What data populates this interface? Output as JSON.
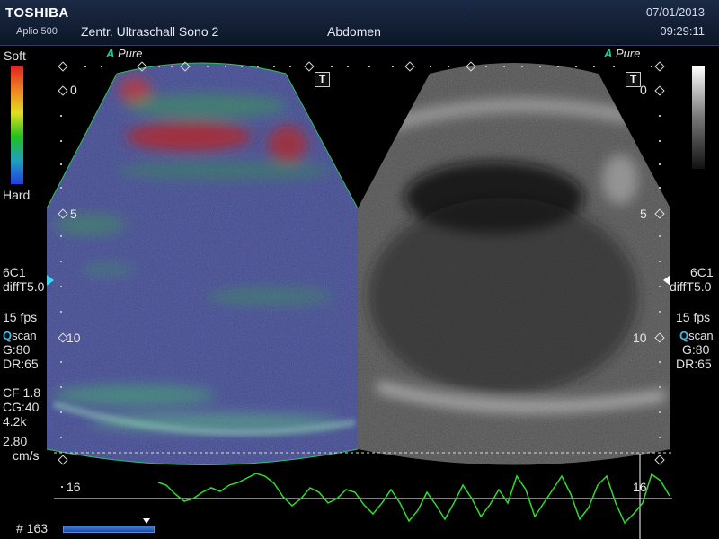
{
  "header": {
    "brand": "TOSHIBA",
    "model": "Aplio 500",
    "institution": "Zentr. Ultraschall Sono 2",
    "preset": "Abdomen",
    "date": "07/01/2013",
    "time": "09:29:11"
  },
  "elasto_scale": {
    "top_label": "Soft",
    "bottom_label": "Hard"
  },
  "left_panel": {
    "probe": "6C1",
    "filter": "diffT5.0",
    "fps": "15 fps",
    "qscan_q": "Q",
    "qscan_rest": "scan",
    "gain": "G:80",
    "dr": "DR:65",
    "cf": "CF 1.8",
    "cg": "CG:40",
    "prf": "4.2k",
    "velocity": "2.80",
    "vel_unit": "cm/s"
  },
  "right_panel": {
    "probe": "6C1",
    "filter": "diffT5.0",
    "fps": "15 fps",
    "qscan_q": "Q",
    "qscan_rest": "scan",
    "gain": "G:80",
    "dr": "DR:65"
  },
  "apure_left": {
    "a": "A",
    "word": "Pure"
  },
  "apure_right": {
    "a": "A",
    "word": "Pure"
  },
  "t_label": "T",
  "depth_marks": [
    "0",
    "5",
    "10",
    "16"
  ],
  "frame_counter": "# 163",
  "colors": {
    "header": "#1b2a45",
    "trace": "#2fdc2f",
    "accent": "#20c8a0"
  }
}
